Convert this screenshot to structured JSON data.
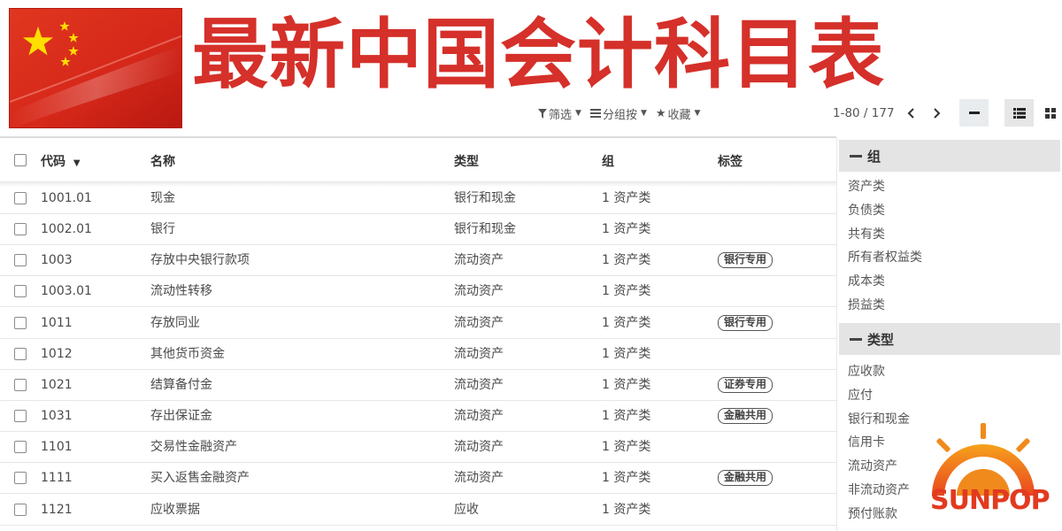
{
  "title": "最新中国会计科目表",
  "controls": {
    "filter": "筛选",
    "group_by": "分组按",
    "favorites": "收藏"
  },
  "pager": {
    "range": "1-80 / 177"
  },
  "columns": {
    "code": "代码",
    "name": "名称",
    "type": "类型",
    "group": "组",
    "tags": "标签"
  },
  "rows": [
    {
      "code": "1001.01",
      "name": "现金",
      "type": "银行和现金",
      "group": "1 资产类",
      "tag": ""
    },
    {
      "code": "1002.01",
      "name": "银行",
      "type": "银行和现金",
      "group": "1 资产类",
      "tag": ""
    },
    {
      "code": "1003",
      "name": "存放中央银行款项",
      "type": "流动资产",
      "group": "1 资产类",
      "tag": "银行专用"
    },
    {
      "code": "1003.01",
      "name": "流动性转移",
      "type": "流动资产",
      "group": "1 资产类",
      "tag": ""
    },
    {
      "code": "1011",
      "name": "存放同业",
      "type": "流动资产",
      "group": "1 资产类",
      "tag": "银行专用"
    },
    {
      "code": "1012",
      "name": "其他货币资金",
      "type": "流动资产",
      "group": "1 资产类",
      "tag": ""
    },
    {
      "code": "1021",
      "name": "结算备付金",
      "type": "流动资产",
      "group": "1 资产类",
      "tag": "证券专用"
    },
    {
      "code": "1031",
      "name": "存出保证金",
      "type": "流动资产",
      "group": "1 资产类",
      "tag": "金融共用"
    },
    {
      "code": "1101",
      "name": "交易性金融资产",
      "type": "流动资产",
      "group": "1 资产类",
      "tag": ""
    },
    {
      "code": "1111",
      "name": "买入返售金融资产",
      "type": "流动资产",
      "group": "1 资产类",
      "tag": "金融共用"
    },
    {
      "code": "1121",
      "name": "应收票据",
      "type": "应收",
      "group": "1 资产类",
      "tag": ""
    }
  ],
  "panel": {
    "group_header": "组",
    "group_items": [
      "资产类",
      "负债类",
      "共有类",
      "所有者权益类",
      "成本类",
      "损益类"
    ],
    "type_header": "类型",
    "type_items": [
      "应收款",
      "应付",
      "银行和现金",
      "信用卡",
      "流动资产",
      "非流动资产",
      "预付账款"
    ]
  },
  "logo": {
    "text": "SUNPOP"
  },
  "colors": {
    "title_red": "#d5302a",
    "flag_red": "#d22a1a",
    "star_yellow": "#ffde00",
    "logo_orange": "#f08a1c",
    "logo_red": "#e23a1f"
  }
}
